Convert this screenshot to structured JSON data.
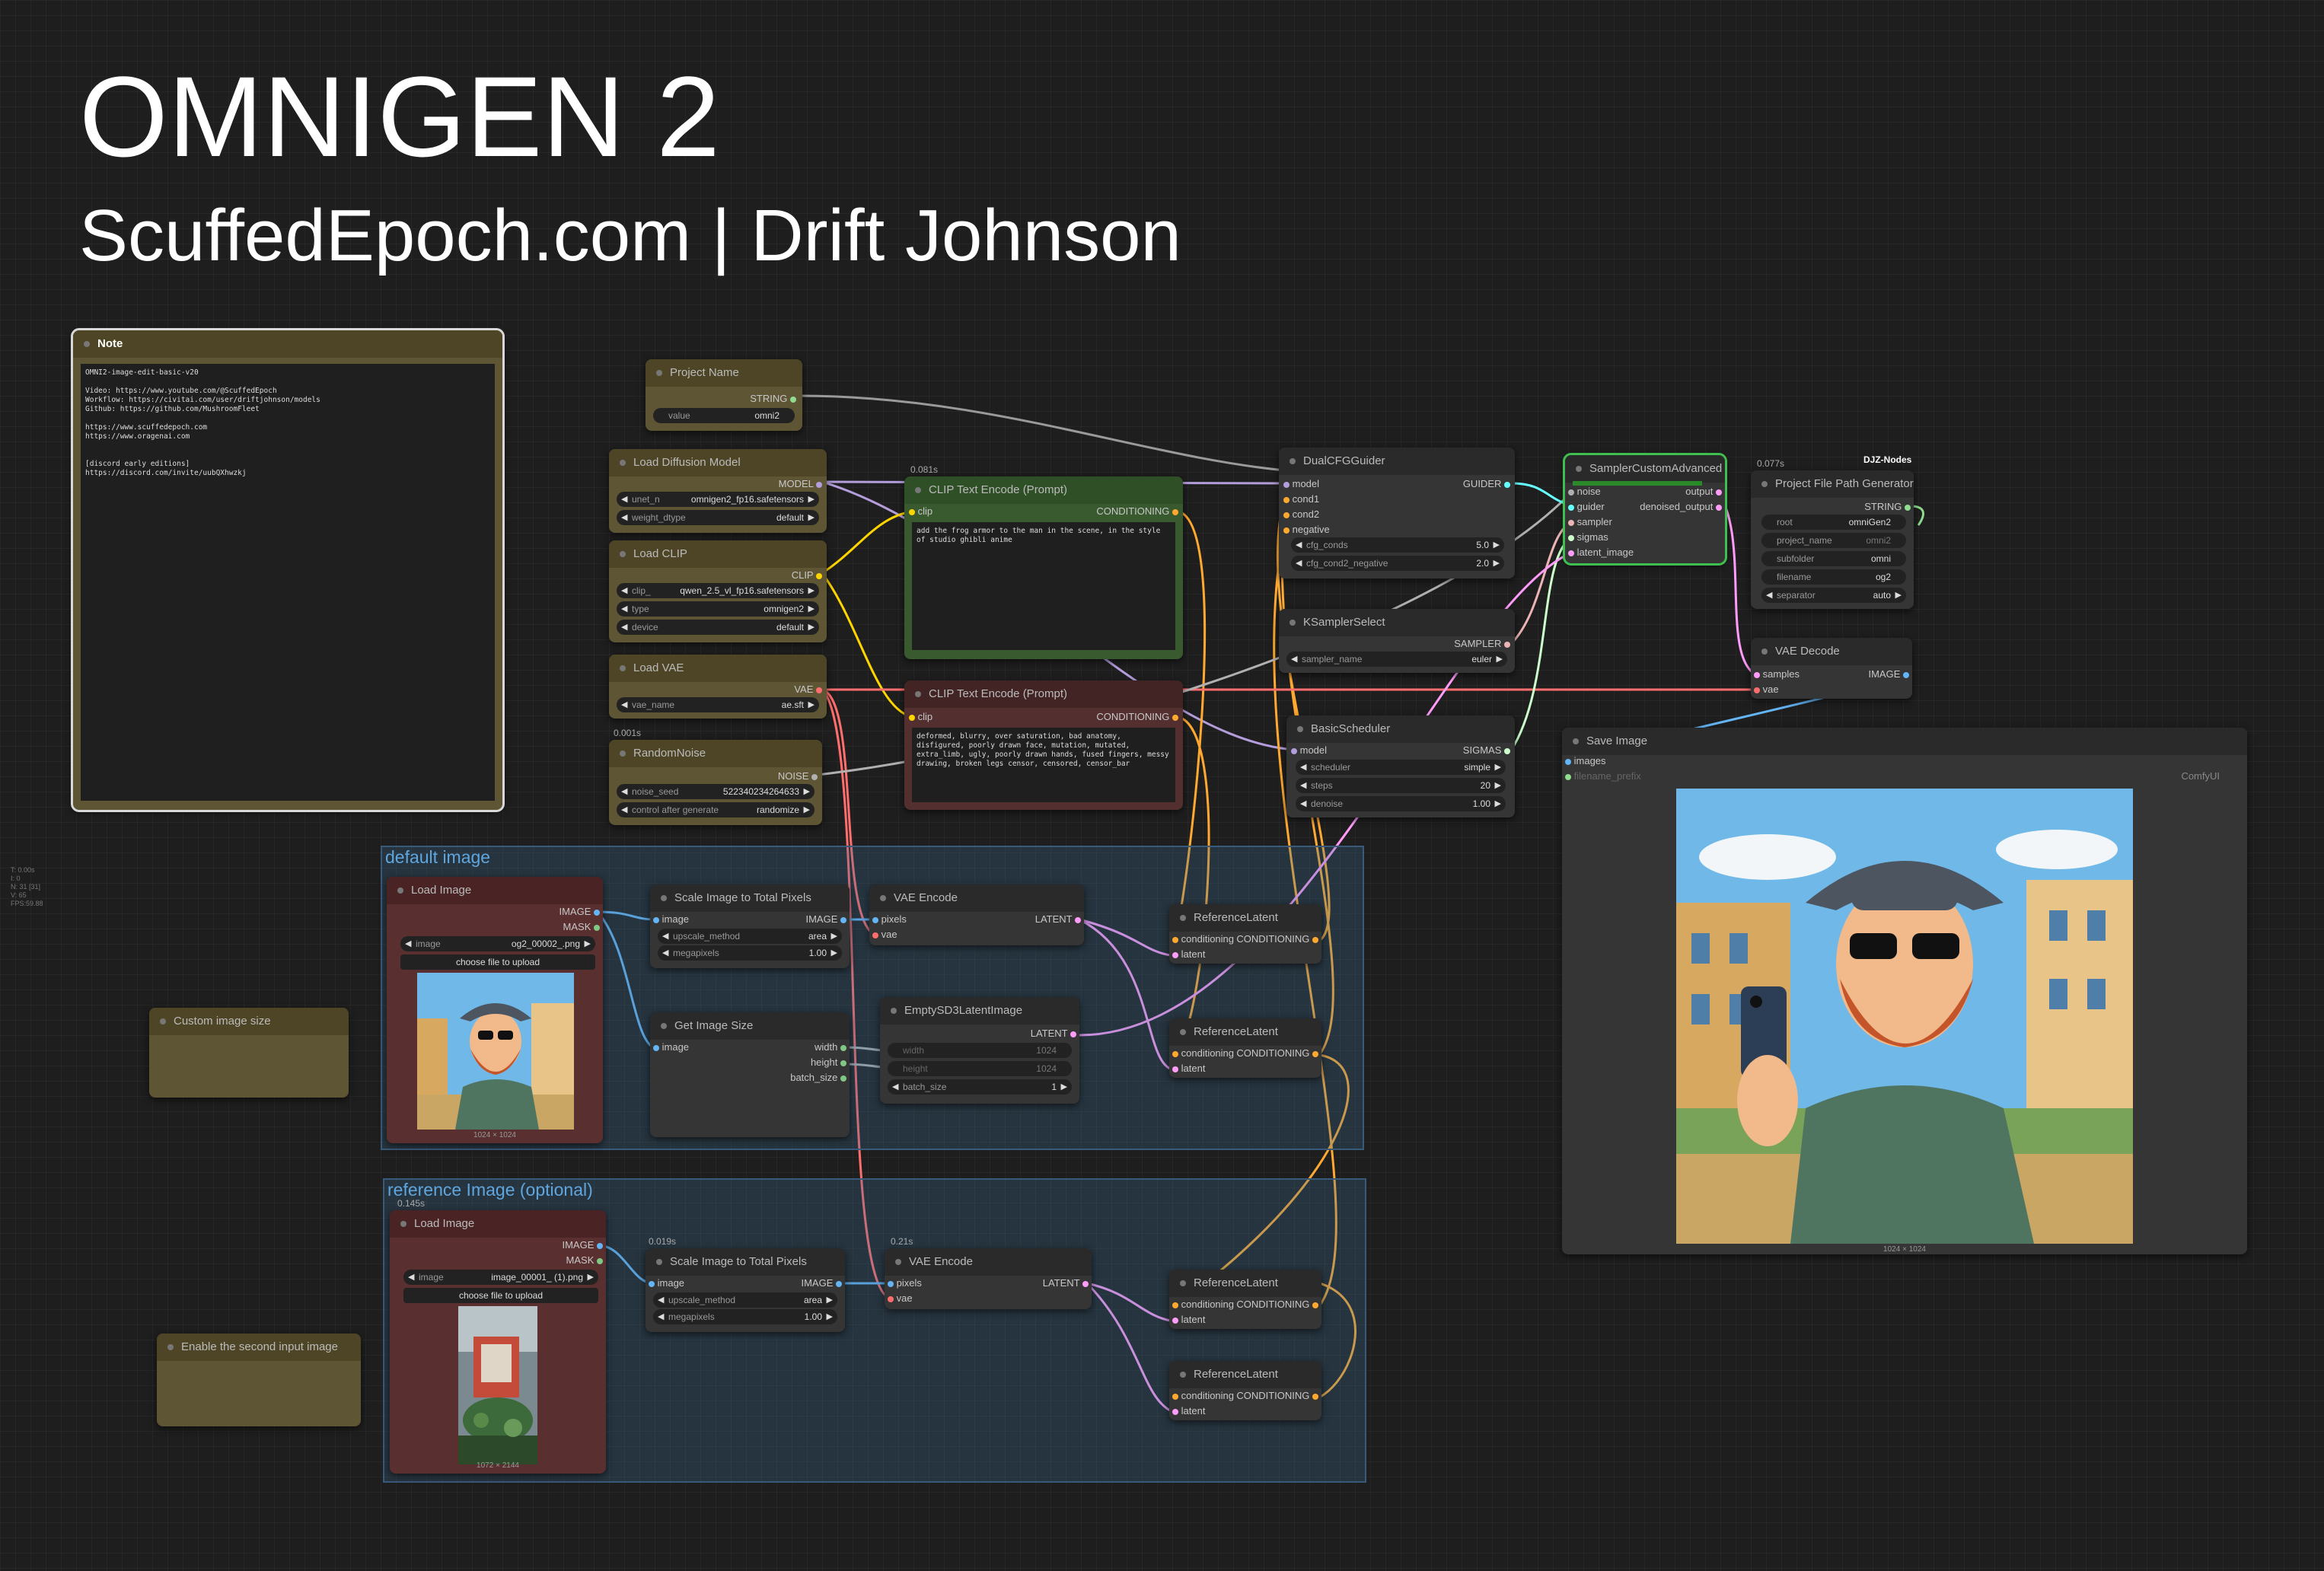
{
  "title": "OMNIGEN 2",
  "subtitle": "ScuffedEpoch.com | Drift Johnson",
  "stats": "T: 0.00s\nI: 0\nN: 31 [31]\nV: 65\nFPS:59.88",
  "groups": {
    "default": "default image",
    "reference": "reference Image (optional)"
  },
  "timings": {
    "clip": "0.081s",
    "noise": "0.001s",
    "project": "0.077s",
    "loadref": "0.145s",
    "scaleref": "0.019s",
    "vaeref": "0.21s"
  },
  "badge": "DJZ-Nodes",
  "note": {
    "title": "Note",
    "text": "OMNI2-image-edit-basic-v20\n\nVideo: https://www.youtube.com/@ScuffedEpoch\nWorkflow: https://civitai.com/user/driftjohnson/models\nGithub: https://github.com/MushroomFleet\n\nhttps://www.scuffedepoch.com\nhttps://www.oragenai.com\n\n\n[discord early editions]\nhttps://discord.com/invite/uubQXhwzkj"
  },
  "project_name": {
    "title": "Project Name",
    "out": "STRING",
    "label": "value",
    "value": "omni2"
  },
  "load_diffusion": {
    "title": "Load Diffusion Model",
    "out": "MODEL",
    "unet_label": "unet_n",
    "unet_value": "omnigen2_fp16.safetensors",
    "dtype_label": "weight_dtype",
    "dtype_value": "default"
  },
  "load_clip": {
    "title": "Load CLIP",
    "out": "CLIP",
    "clip_label": "clip_",
    "clip_value": "qwen_2.5_vl_fp16.safetensors",
    "type_label": "type",
    "type_value": "omnigen2",
    "device_label": "device",
    "device_value": "default"
  },
  "load_vae": {
    "title": "Load VAE",
    "out": "VAE",
    "label": "vae_name",
    "value": "ae.sft"
  },
  "random_noise": {
    "title": "RandomNoise",
    "out": "NOISE",
    "seed_label": "noise_seed",
    "seed_value": "522340234264633",
    "cag_label": "control after generate",
    "cag_value": "randomize"
  },
  "clip_pos": {
    "title": "CLIP Text Encode (Prompt)",
    "in": "clip",
    "out": "CONDITIONING",
    "text": "add the frog armor to the man in the scene, in the style of studio ghibli anime"
  },
  "clip_neg": {
    "title": "CLIP Text Encode (Prompt)",
    "in": "clip",
    "out": "CONDITIONING",
    "text": "deformed, blurry, over saturation, bad anatomy, disfigured, poorly drawn face, mutation, mutated, extra_limb, ugly, poorly drawn hands, fused fingers, messy drawing, broken legs censor, censored, censor_bar"
  },
  "dual_cfg": {
    "title": "DualCFGGuider",
    "inputs": [
      "model",
      "cond1",
      "cond2",
      "negative"
    ],
    "out": "GUIDER",
    "cfg_label": "cfg_conds",
    "cfg_value": "5.0",
    "cfg2_label": "cfg_cond2_negative",
    "cfg2_value": "2.0"
  },
  "ksampler_select": {
    "title": "KSamplerSelect",
    "out": "SAMPLER",
    "label": "sampler_name",
    "value": "euler"
  },
  "basic_scheduler": {
    "title": "BasicScheduler",
    "in": "model",
    "out": "SIGMAS",
    "sched_label": "scheduler",
    "sched_value": "simple",
    "steps_label": "steps",
    "steps_value": "20",
    "denoise_label": "denoise",
    "denoise_value": "1.00"
  },
  "sampler_adv": {
    "title": "SamplerCustomAdvanced",
    "inputs": [
      "noise",
      "guider",
      "sampler",
      "sigmas",
      "latent_image"
    ],
    "outputs": [
      "output",
      "denoised_output"
    ]
  },
  "project_path": {
    "title": "Project File Path Generator",
    "out": "STRING",
    "root_label": "root",
    "root_value": "omniGen2",
    "pn_label": "project_name",
    "pn_value": "omni2",
    "sub_label": "subfolder",
    "sub_value": "omni",
    "fn_label": "filename",
    "fn_value": "og2",
    "sep_label": "separator",
    "sep_value": "auto"
  },
  "vae_decode": {
    "title": "VAE Decode",
    "in1": "samples",
    "in2": "vae",
    "out": "IMAGE"
  },
  "save_image": {
    "title": "Save Image",
    "in1": "images",
    "in2": "filename_prefix",
    "prefix_value": "ComfyUI",
    "size": "1024 × 1024"
  },
  "load_image_default": {
    "title": "Load Image",
    "out1": "IMAGE",
    "out2": "MASK",
    "label": "image",
    "value": "og2_00002_.png",
    "button": "choose file to upload",
    "size": "1024 × 1024"
  },
  "scale_default": {
    "title": "Scale Image to Total Pixels",
    "in": "image",
    "out": "IMAGE",
    "method_label": "upscale_method",
    "method_value": "area",
    "mp_label": "megapixels",
    "mp_value": "1.00"
  },
  "vae_encode_default": {
    "title": "VAE Encode",
    "in1": "pixels",
    "in2": "vae",
    "out": "LATENT"
  },
  "get_size": {
    "title": "Get Image Size",
    "in": "image",
    "outputs": [
      "width",
      "height",
      "batch_size"
    ]
  },
  "empty_latent": {
    "title": "EmptySD3LatentImage",
    "out": "LATENT",
    "width_label": "width",
    "width_value": "1024",
    "height_label": "height",
    "height_value": "1024",
    "batch_label": "batch_size",
    "batch_value": "1"
  },
  "ref_latent_1": {
    "title": "ReferenceLatent",
    "in1": "conditioning",
    "in2": "latent",
    "out": "CONDITIONING"
  },
  "ref_latent_2": {
    "title": "ReferenceLatent",
    "in1": "conditioning",
    "in2": "latent",
    "out": "CONDITIONING"
  },
  "ref_latent_3": {
    "title": "ReferenceLatent",
    "in1": "conditioning",
    "in2": "latent",
    "out": "CONDITIONING"
  },
  "ref_latent_4": {
    "title": "ReferenceLatent",
    "in1": "conditioning",
    "in2": "latent",
    "out": "CONDITIONING"
  },
  "custom_size": {
    "title": "Custom image size"
  },
  "enable_second": {
    "title": "Enable the second input image"
  },
  "load_image_ref": {
    "title": "Load Image",
    "out1": "IMAGE",
    "out2": "MASK",
    "label": "image",
    "value": "image_00001_ (1).png",
    "button": "choose file to upload",
    "size": "1072 × 2144"
  },
  "scale_ref": {
    "title": "Scale Image to Total Pixels",
    "in": "image",
    "out": "IMAGE",
    "method_label": "upscale_method",
    "method_value": "area",
    "mp_label": "megapixels",
    "mp_value": "1.00"
  },
  "vae_encode_ref": {
    "title": "VAE Encode",
    "in1": "pixels",
    "in2": "vae",
    "out": "LATENT"
  },
  "colors": {
    "model": "#b39ddb",
    "clip": "#ffd500",
    "vae": "#ff6e6e",
    "conditioning": "#ffa931",
    "latent": "#ff9cf9",
    "image": "#64b5f6",
    "noise": "#b0b0b0",
    "guider": "#66ffff",
    "sampler": "#ecb4b4",
    "sigmas": "#cdffcd",
    "string": "#8fdc8f"
  }
}
